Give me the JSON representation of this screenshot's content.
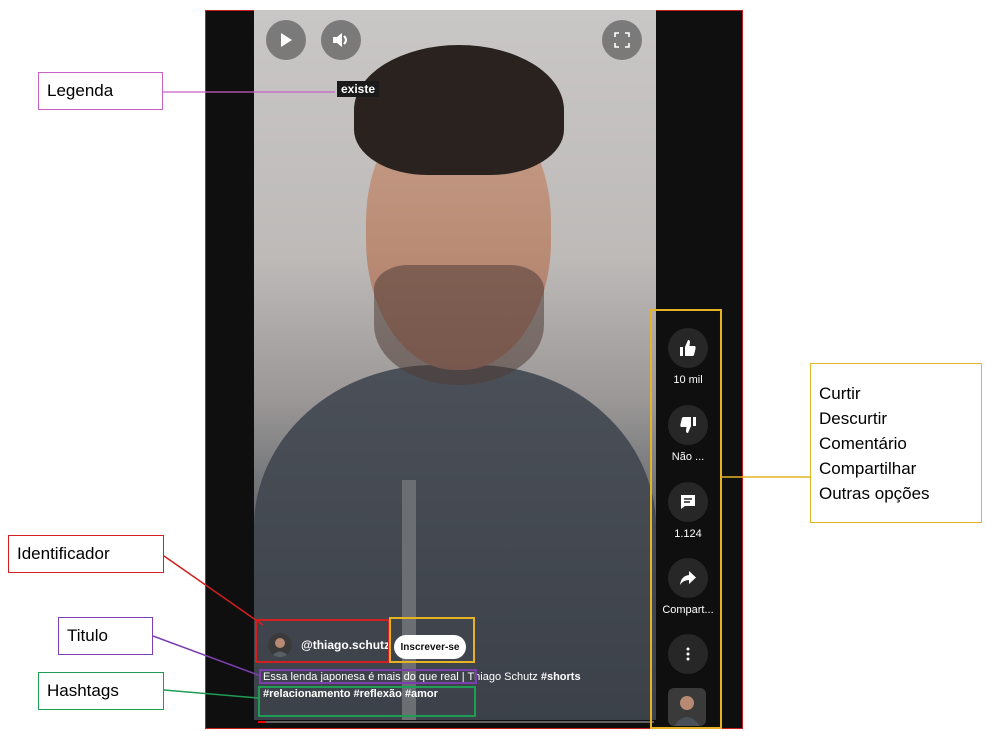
{
  "video": {
    "caption_word": "existe",
    "channel_handle": "@thiago.schutz",
    "subscribe_label": "Inscrever-se",
    "title": "Essa lenda japonesa é mais do que real | Thiago Schutz",
    "title_tag": "#shorts",
    "hashtags": "#relacionamento #reflexão #amor",
    "progress_percent": 2
  },
  "rail": {
    "like_count": "10 mil",
    "dislike_label": "Não ...",
    "comment_count": "1.124",
    "share_label": "Compart..."
  },
  "annotations": {
    "legenda": "Legenda",
    "identificador": "Identificador",
    "titulo": "Titulo",
    "hashtags": "Hashtags",
    "actions": [
      "Curtir",
      "Descurtir",
      "Comentário",
      "Compartilhar",
      "Outras opções"
    ]
  },
  "colors": {
    "legenda": "#c861c8",
    "identificador": "#d21f1f",
    "titulo": "#7b3fb0",
    "hashtags": "#1f9d55",
    "actions": "#e6b422"
  },
  "icons": {
    "play": "play-icon",
    "volume": "volume-icon",
    "fullscreen": "fullscreen-icon",
    "like": "thumbs-up-icon",
    "dislike": "thumbs-down-icon",
    "comment": "comment-icon",
    "share": "share-icon",
    "more": "more-vertical-icon"
  }
}
